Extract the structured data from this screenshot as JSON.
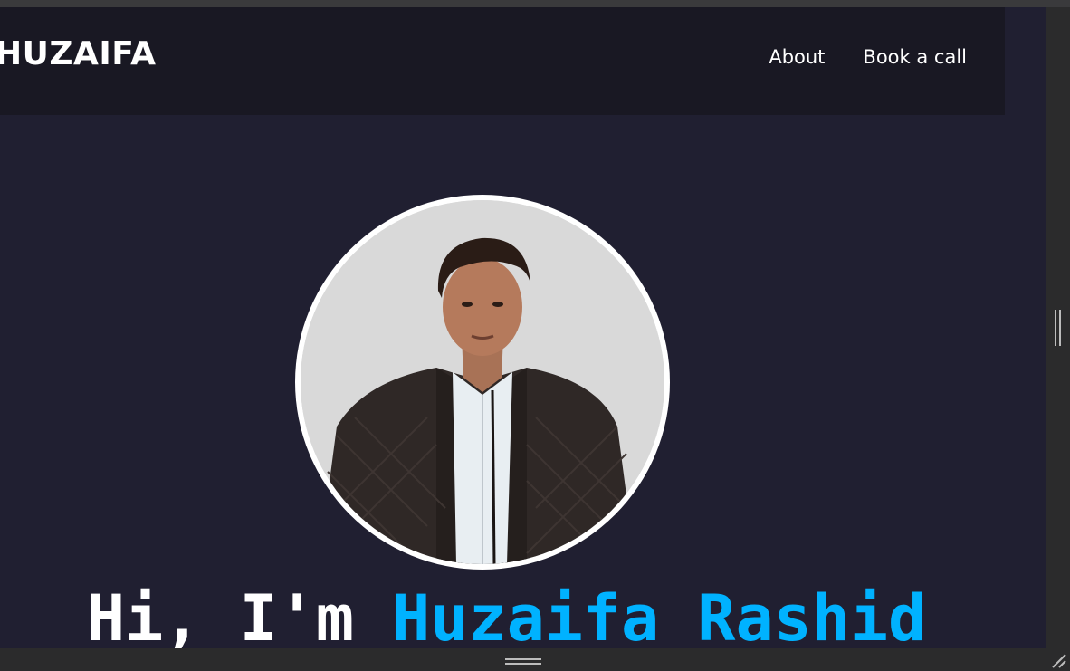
{
  "navbar": {
    "brand": "HUZAIFA",
    "links": [
      {
        "label": "About"
      },
      {
        "label": "Book a call"
      }
    ]
  },
  "hero": {
    "greeting": "Hi, I'm ",
    "name": "Huzaifa Rashid"
  },
  "colors": {
    "page_bg": "#201f31",
    "navbar_bg": "#191823",
    "accent": "#00b2ff",
    "text": "#ffffff"
  }
}
